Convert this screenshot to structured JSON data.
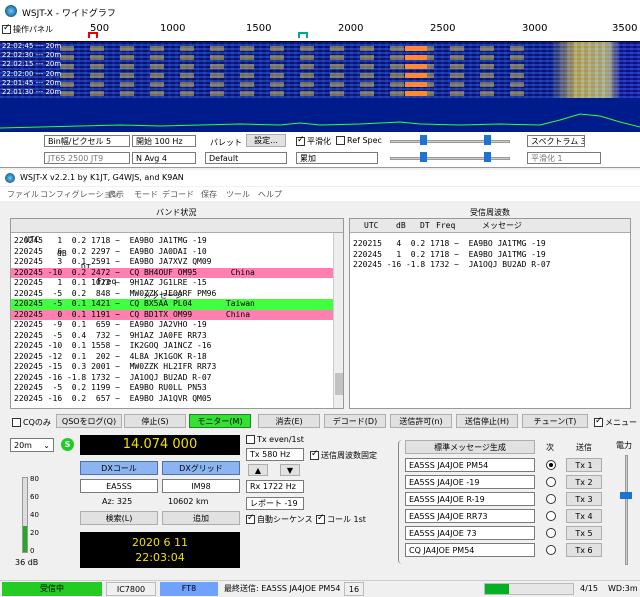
{
  "wide": {
    "title": "WSJT-X - ワイドグラフ",
    "ctrl_panel": "操作パネル",
    "scale": [
      "500",
      "1000",
      "1500",
      "2000",
      "2500",
      "3000",
      "3500"
    ],
    "times": [
      "22:02:45 --- 20m",
      "22:02:30 --- 20m",
      "22:02:15 --- 20m",
      "22:02:00 --- 20m",
      "22:01:45 --- 20m",
      "22:01:30 --- 20m"
    ],
    "bins_label": "Bin幅/ピクセル  5",
    "start_label": "開始 100 Hz",
    "palette_label": "パレット",
    "settings_btn": "設定...",
    "smooth": "平滑化",
    "ref_spec": "Ref Spec",
    "spectrum": "スペクトラム 30 %",
    "jt": "JT65  2500  JT9",
    "navg": "N Avg 4",
    "palette_value": "Default",
    "accum": "累加",
    "smooth_val": "平滑化  1"
  },
  "main": {
    "title": "WSJT-X   v2.2.1   by K1JT, G4WJS, and K9AN",
    "menu": [
      "ファイル",
      "コンフィグレーション",
      "表示",
      "モード",
      "デコード",
      "保存",
      "ツール",
      "ヘルプ"
    ],
    "band_title": "バンド状況",
    "rx_title": "受信周波数",
    "headers": {
      "utc": "UTC",
      "db": "dB",
      "dt": "DT",
      "freq": "Freq",
      "msg": "メッセージ"
    },
    "band_rows": [
      {
        "t": "220245   1  0.2 1718 ~  EA9BO JA1TMG -19",
        "c": ""
      },
      {
        "t": "220245   6  0.2 2297 ~  EA9BO JA0DAI -10",
        "c": ""
      },
      {
        "t": "220245   3  0.1 2591 ~  EA9BO JA7XVZ QM09",
        "c": ""
      },
      {
        "t": "220245 -10  0.2 2472 ~  CQ BH4OUF OM95       China",
        "c": "pink"
      },
      {
        "t": "220245   1  0.1 1022 ~  9H1AZ JG1LRE -15",
        "c": ""
      },
      {
        "t": "220245  -5  0.2  848 ~  MW0ZZK JE0ARF PM96",
        "c": ""
      },
      {
        "t": "220245  -5  0.1 1421 ~  CQ BX5AA PL04       Taiwan",
        "c": "green"
      },
      {
        "t": "220245   0  0.1 1191 ~  CQ BD1TX OM99       China",
        "c": "pink"
      },
      {
        "t": "220245  -9  0.1  659 ~  EA9BO JA2VHO -19",
        "c": ""
      },
      {
        "t": "220245  -5  0.4  732 ~  9H1AZ JA0FE RR73",
        "c": ""
      },
      {
        "t": "220245 -10  0.1 1558 ~  IK2GOQ JA1NCZ -16",
        "c": ""
      },
      {
        "t": "220245 -12  0.1  202 ~  4L8A JK1GOK R-18",
        "c": ""
      },
      {
        "t": "220245 -15  0.3 2001 ~  MW0ZZK HL2IFR RR73",
        "c": ""
      },
      {
        "t": "220245 -16 -1.8 1732 ~  JA1OQJ BU2AD R-07",
        "c": ""
      },
      {
        "t": "220245  -5  0.2 1199 ~  EA9BO RU0LL PN53",
        "c": ""
      },
      {
        "t": "220245 -16  0.2  657 ~  EA9BO JA1QVR QM05",
        "c": ""
      }
    ],
    "rx_rows": [
      "220215   4  0.2 1718 ~  EA9BO JA1TMG -19",
      "220245   1  0.2 1718 ~  EA9BO JA1TMG -19",
      "220245 -16 -1.8 1732 ~  JA1OQJ BU2AD R-07"
    ],
    "buttons": {
      "cq_only": "CQのみ",
      "qso_log": "QSOをログ(Q)",
      "stop": "停止(S)",
      "monitor": "モニター(M)",
      "erase": "消去(E)",
      "decode": "デコード(D)",
      "tx_enable": "送信許可(n)",
      "halt_tx": "送信停止(H)",
      "tune": "チューン(T)",
      "menu_chk": "メニュー"
    },
    "band": "20m",
    "freq": "14.074 000",
    "dx_call_btn": "DXコール",
    "dx_grid_btn": "DXグリッド",
    "dx_call": "EA5SS",
    "dx_grid": "IM98",
    "az": "Az: 325",
    "dist": "10602 km",
    "lookup": "検索(L)",
    "add": "追加",
    "date": "2020 6 11",
    "time": "22:03:04",
    "level": "36 dB",
    "meter_ticks": [
      "80",
      "60",
      "40",
      "20",
      "0"
    ],
    "tx_even": "Tx even/1st",
    "tx_hz": "Tx  580  Hz",
    "hold_tx": "送信周波数固定",
    "rx_hz": "Rx  1722  Hz",
    "report": "レポート -19",
    "auto_seq": "自動シーケンス",
    "call1st": "コール 1st",
    "gen_msgs": "標準メッセージ生成",
    "next": "次",
    "send": "送信",
    "tx_msgs": [
      "EA5SS JA4JOE PM54",
      "EA5SS JA4JOE -19",
      "EA5SS JA4JOE R-19",
      "EA5SS JA4JOE RR73",
      "EA5SS JA4JOE 73",
      "CQ JA4JOE PM54"
    ],
    "tx_btns": [
      "Tx 1",
      "Tx 2",
      "Tx 3",
      "Tx 4",
      "Tx 5",
      "Tx 6"
    ],
    "power": "電力",
    "status": {
      "rx": "受信中",
      "rig": "IC7800",
      "mode": "FT8",
      "last_tx": "最終送信: EA5SS JA4JOE PM54",
      "num": "16",
      "prog": "4/15",
      "wd": "WD:3m"
    }
  }
}
